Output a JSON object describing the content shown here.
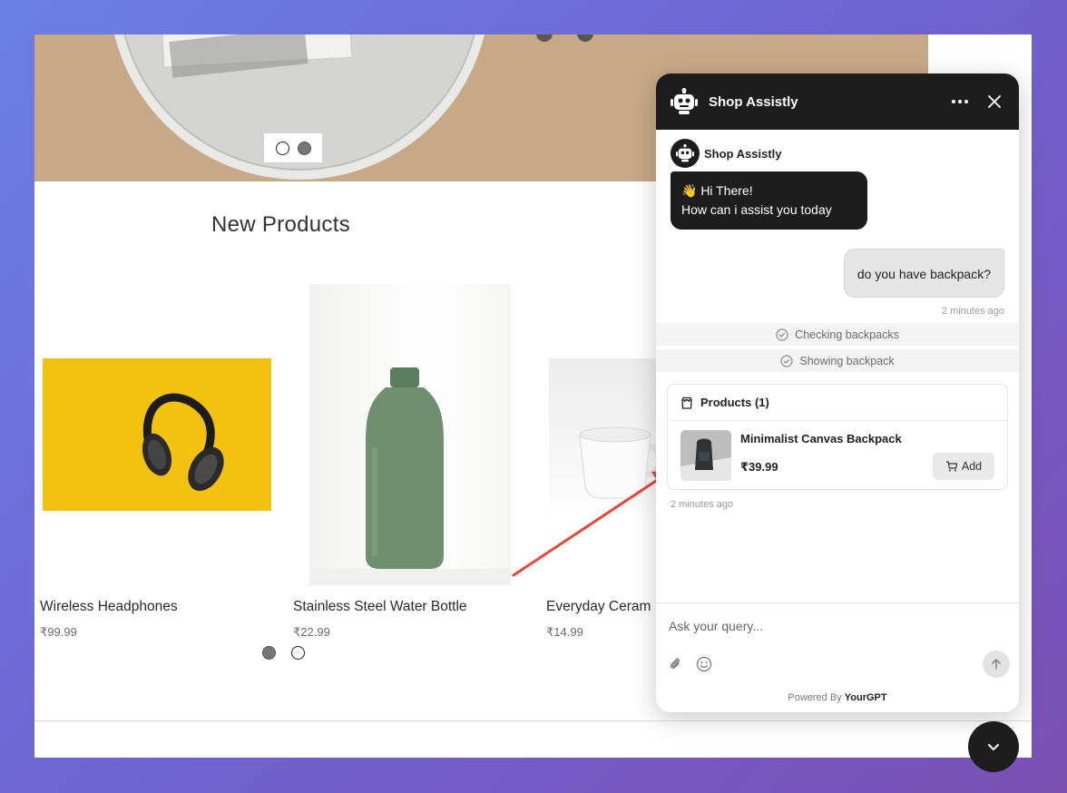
{
  "page": {
    "section_title": "New Products",
    "products": [
      {
        "name": "Wireless Headphones",
        "price": "₹99.99"
      },
      {
        "name": "Stainless Steel Water Bottle",
        "price": "₹22.99"
      },
      {
        "name": "Everyday Ceram",
        "price": "₹14.99"
      }
    ]
  },
  "chat": {
    "title": "Shop Assistly",
    "sender_name": "Shop Assistly",
    "bot_greeting_line1": "👋 Hi There!",
    "bot_greeting_line2": "How can i assist you today",
    "user_message": "do you have backpack?",
    "user_timestamp": "2 minutes ago",
    "status_1": "Checking backpacks",
    "status_2": "Showing backpack",
    "products_header": "Products (1)",
    "product_title": "Minimalist Canvas Backpack",
    "product_price": "₹39.99",
    "add_label": "Add",
    "bot_timestamp": "2 minutes ago",
    "input_placeholder": "Ask your query...",
    "powered_prefix": "Powered By",
    "powered_brand": "YourGPT"
  },
  "colors": {
    "header": "#1d1d1d",
    "accent_arrow": "#e8453c"
  },
  "icons": [
    "robot-icon",
    "more-icon",
    "close-icon",
    "check-circle-icon",
    "bag-icon",
    "cart-icon",
    "paperclip-icon",
    "emoji-icon",
    "arrow-up-icon",
    "chevron-down-icon"
  ]
}
